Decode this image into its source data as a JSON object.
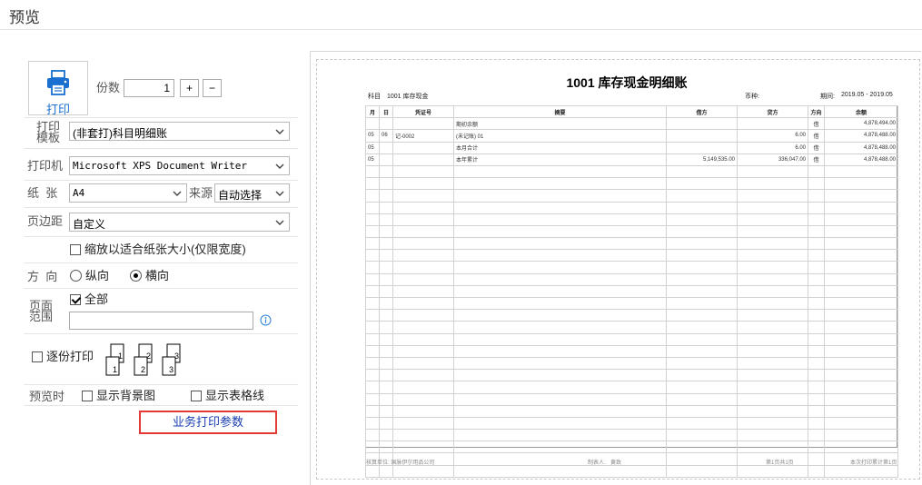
{
  "window": {
    "title": "预览"
  },
  "print_panel": {
    "print_button": "打印",
    "copies_label": "份数",
    "copies_value": "1",
    "plus": "+",
    "minus": "−",
    "template_label_1": "打印",
    "template_label_2": "模板",
    "template_value": "(非套打)科目明细账",
    "printer_label": "打印机",
    "printer_value": "Microsoft XPS Document Writer",
    "paper_label": "纸  张",
    "paper_value": "A4",
    "source_label": "来源",
    "source_value": "自动选择",
    "margin_label": "页边距",
    "margin_value": "自定义",
    "fit_label": "缩放以适合纸张大小(仅限宽度)",
    "fit_checked": false,
    "orientation_label": "方  向",
    "portrait_label": "纵向",
    "landscape_label": "横向",
    "orientation_selected": "横向",
    "range_label_1": "页面",
    "range_label_2": "范围",
    "all_label": "全部",
    "all_checked": true,
    "range_input": "",
    "collate_label": "逐份打印",
    "collate_checked": false,
    "collate_icons": [
      "1",
      "1",
      "2",
      "2",
      "3",
      "3"
    ],
    "preview_label": "预览时",
    "show_bg_label": "显示背景图",
    "show_grid_label": "显示表格线",
    "business_params_button": "业务打印参数"
  },
  "report": {
    "title": "1001 库存现金明细账",
    "subject_label": "科目",
    "subject_value": "1001 库存现金",
    "currency_label": "币种:",
    "period_label": "期间:",
    "period_value": "2019.05 - 2019.05",
    "columns": [
      "月",
      "日",
      "凭证号",
      "摘要",
      "借方",
      "贷方",
      "方向",
      "余额"
    ],
    "rows": [
      [
        "",
        "",
        "",
        "期初余额",
        "",
        "",
        "借",
        "4,878,494.00"
      ],
      [
        "05",
        "06",
        "记-0002",
        "(未记账) 01",
        "",
        "6.00",
        "借",
        "4,878,488.00"
      ],
      [
        "05",
        "",
        "",
        "本月合计",
        "",
        "6.00",
        "借",
        "4,878,488.00"
      ],
      [
        "05",
        "",
        "",
        "本年累计",
        "5,149,535.00",
        "336,047.00",
        "借",
        "4,878,488.00"
      ]
    ],
    "empty_row_count": 26,
    "footer_company": "核算单位: 国脉伊尔用品公司",
    "footer_maker_label": "制表人:",
    "footer_maker": "黄致",
    "footer_page": "第1页共1页",
    "footer_total_pages": "本次打印累计第1页"
  }
}
